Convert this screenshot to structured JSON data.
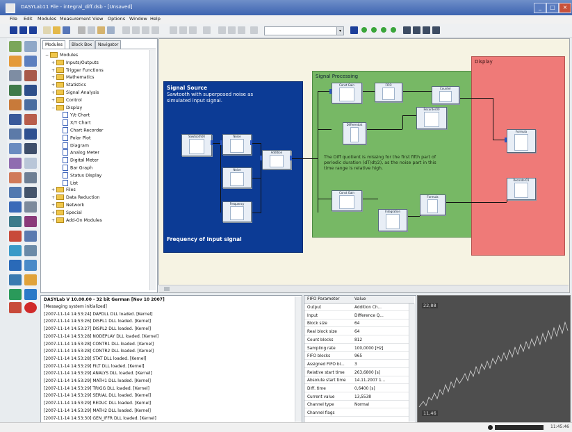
{
  "window": {
    "title": "DASYLab11 File - integral_diff.dsb - [Unsaved]"
  },
  "menu": [
    "File",
    "Edit",
    "Modules",
    "Measurement",
    "View",
    "Options",
    "Window",
    "Help"
  ],
  "tree": {
    "tabs": [
      "Modules",
      "Block Box",
      "Navigator"
    ],
    "items": [
      {
        "label": "Modules",
        "level": 0,
        "kind": "folder",
        "sign": "−"
      },
      {
        "label": "Inputs/Outputs",
        "level": 1,
        "kind": "folder",
        "sign": "+"
      },
      {
        "label": "Trigger Functions",
        "level": 1,
        "kind": "folder",
        "sign": "+"
      },
      {
        "label": "Mathematics",
        "level": 1,
        "kind": "folder",
        "sign": "+"
      },
      {
        "label": "Statistics",
        "level": 1,
        "kind": "folder",
        "sign": "+"
      },
      {
        "label": "Signal Analysis",
        "level": 1,
        "kind": "folder",
        "sign": "+"
      },
      {
        "label": "Control",
        "level": 1,
        "kind": "folder",
        "sign": "+"
      },
      {
        "label": "Display",
        "level": 1,
        "kind": "folder",
        "sign": "−"
      },
      {
        "label": "Y/t-Chart",
        "level": 2,
        "kind": "doc",
        "sign": ""
      },
      {
        "label": "X/Y Chart",
        "level": 2,
        "kind": "doc",
        "sign": ""
      },
      {
        "label": "Chart Recorder",
        "level": 2,
        "kind": "doc",
        "sign": ""
      },
      {
        "label": "Polar Plot",
        "level": 2,
        "kind": "doc",
        "sign": ""
      },
      {
        "label": "Diagram",
        "level": 2,
        "kind": "doc",
        "sign": ""
      },
      {
        "label": "Analog Meter",
        "level": 2,
        "kind": "doc",
        "sign": ""
      },
      {
        "label": "Digital Meter",
        "level": 2,
        "kind": "doc",
        "sign": ""
      },
      {
        "label": "Bar Graph",
        "level": 2,
        "kind": "doc",
        "sign": ""
      },
      {
        "label": "Status Display",
        "level": 2,
        "kind": "doc",
        "sign": ""
      },
      {
        "label": "List",
        "level": 2,
        "kind": "doc",
        "sign": ""
      },
      {
        "label": "Files",
        "level": 1,
        "kind": "folder",
        "sign": "+"
      },
      {
        "label": "Data Reduction",
        "level": 1,
        "kind": "folder",
        "sign": "+"
      },
      {
        "label": "Network",
        "level": 1,
        "kind": "folder",
        "sign": "+"
      },
      {
        "label": "Special",
        "level": 1,
        "kind": "folder",
        "sign": "+"
      },
      {
        "label": "Add-On Modules",
        "level": 1,
        "kind": "folder",
        "sign": "+"
      }
    ]
  },
  "canvas": {
    "signal_source": {
      "title": "Signal Source",
      "subtitle": "Sawtooth with superposed noise as simulated input signal.",
      "footer": "Frequency of input signal"
    },
    "signal_processing": {
      "title": "Signal Processing",
      "note": "The Diff quotient is missing for the first fifth part of periodic duration (dT/dt/2), as the noise part in this time range is relative high."
    },
    "display": {
      "title": "Display"
    },
    "blocks": {
      "sawtooth": "Sawtooth00",
      "noise": "Noise",
      "generator": "Noise",
      "frequency": "Frequency",
      "addition": "Addition",
      "const_gain_a": "Const Gain",
      "fifo": "FIFO",
      "counter": "Counter",
      "differentiation": "Differentiat",
      "recorder_a": "Recorder00",
      "const_gain_b": "Const Gain",
      "integration": "Integration",
      "formula_b": "Formula",
      "formula_display": "Formula",
      "recorder_b": "Recorder01"
    }
  },
  "log": {
    "header": "DASYLab V 10.00.00 - 32 bit German [Nov 10 2007]",
    "lines": [
      "[Messaging system initialized]",
      "[2007-11-14 14:53:24] DAPDLL DLL loaded. [Kernel]",
      "[2007-11-14 14:53:26] DISPL1 DLL loaded. [Kernel]",
      "[2007-11-14 14:53:27] DISPL2 DLL loaded. [Kernel]",
      "[2007-11-14 14:53:28] NODEPLAY DLL loaded. [Kernel]",
      "[2007-11-14 14:53:28] CONTR1 DLL loaded. [Kernel]",
      "[2007-11-14 14:53:28] CONTR2 DLL loaded. [Kernel]",
      "[2007-11-14 14:53:28] STAT DLL loaded. [Kernel]",
      "[2007-11-14 14:53:29] FILT DLL loaded. [Kernel]",
      "[2007-11-14 14:53:29] ANALYS DLL loaded. [Kernel]",
      "[2007-11-14 14:53:29] MATH1 DLL loaded. [Kernel]",
      "[2007-11-14 14:53:29] TRIGG DLL loaded. [Kernel]",
      "[2007-11-14 14:53:29] SERIAL DLL loaded. [Kernel]",
      "[2007-11-14 14:53:29] REDUC DLL loaded. [Kernel]",
      "[2007-11-14 14:53:29] MATH2 DLL loaded. [Kernel]",
      "[2007-11-14 14:53:30] GEN_IFFR DLL loaded. [Kernel]"
    ]
  },
  "fifo": {
    "headers": [
      "FIFO Parameter",
      "Value"
    ],
    "rows": [
      {
        "k": "Output",
        "v": "Addition Ch..."
      },
      {
        "k": "Input",
        "v": "Difference Q..."
      },
      {
        "k": "Block size",
        "v": "64"
      },
      {
        "k": "Real block size",
        "v": "64"
      },
      {
        "k": "Count blocks",
        "v": "812"
      },
      {
        "k": "Sampling rate",
        "v": "100,0000 [Hz]"
      },
      {
        "k": "FIFO blocks",
        "v": "965"
      },
      {
        "k": "Assigned FIFO bl...",
        "v": "3"
      },
      {
        "k": "Relative start time",
        "v": "263,6800 [s]"
      },
      {
        "k": "Absolute start time",
        "v": "14.11.2007 1..."
      },
      {
        "k": "Diff. time",
        "v": "0,6400 [s]"
      },
      {
        "k": "Current value",
        "v": "13,5538"
      },
      {
        "k": "Channel type",
        "v": "Normal"
      },
      {
        "k": "Channel flags",
        "v": ""
      }
    ]
  },
  "recorder": {
    "top_label": "22,88",
    "bottom_label": "11,46"
  },
  "status": {
    "time": "11:45:46"
  },
  "colors": {
    "source": "#0c3b95",
    "processing": "#77b865",
    "display": "#ef7a78"
  }
}
